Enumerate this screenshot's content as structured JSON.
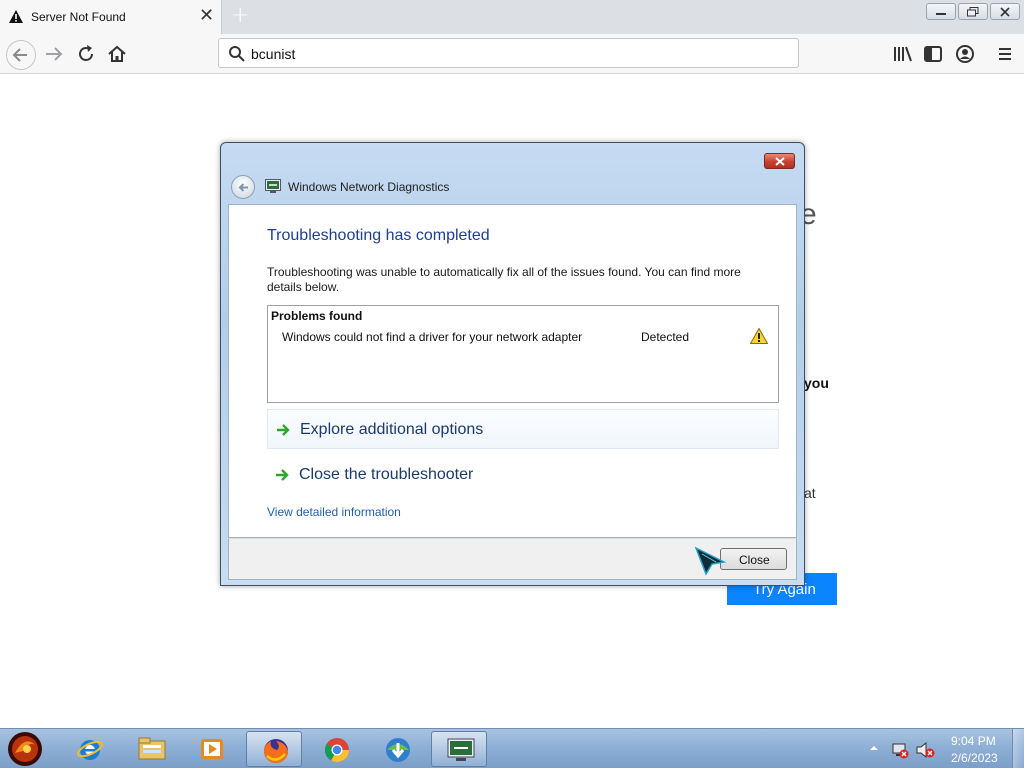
{
  "browser": {
    "tab": {
      "title": "Server Not Found",
      "icon": "warning-icon"
    },
    "url_value": "bcunist",
    "toolbar_icons": [
      "back-icon",
      "forward-icon",
      "reload-icon",
      "home-icon",
      "library-icon",
      "sidebar-icon",
      "account-icon",
      "menu-icon"
    ]
  },
  "error_page": {
    "frag_heading": "e",
    "frag_bold": "you",
    "frag_text": "at",
    "try_again_label": "Try Again",
    "accent": "#0a84ff"
  },
  "dialog": {
    "title": "Windows Network Diagnostics",
    "heading": "Troubleshooting has completed",
    "description": "Troubleshooting was unable to automatically fix all of the issues found. You can find more details below.",
    "problems": {
      "header": "Problems found",
      "items": [
        {
          "text": "Windows could not find a driver for your network adapter",
          "status": "Detected",
          "icon": "warning-icon"
        }
      ]
    },
    "options": {
      "explore": "Explore additional options",
      "close_troubleshooter": "Close the troubleshooter"
    },
    "detail_link": "View detailed information",
    "close_button": "Close"
  },
  "taskbar": {
    "time": "9:04 PM",
    "date": "2/6/2023",
    "apps": [
      "start-orb",
      "internet-explorer-icon",
      "file-explorer-icon",
      "media-player-icon",
      "firefox-icon",
      "chrome-icon",
      "download-manager-icon",
      "network-diagnostics-icon"
    ]
  }
}
